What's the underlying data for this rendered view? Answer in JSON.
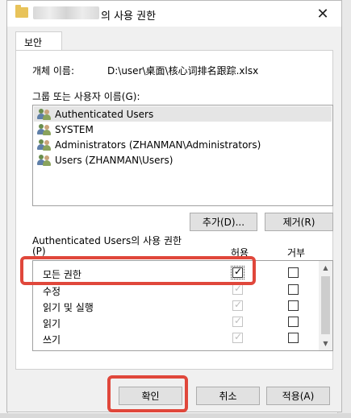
{
  "window": {
    "title": "의 사용 권한",
    "close_glyph": "✕"
  },
  "tab": {
    "label": "보안"
  },
  "object": {
    "label": "개체 이름:",
    "value": "D:\\user\\桌面\\核心词排名跟踪.xlsx"
  },
  "groups": {
    "label": "그룹 또는 사용자 이름(G):",
    "items": [
      {
        "name": "Authenticated Users"
      },
      {
        "name": "SYSTEM"
      },
      {
        "name": "Administrators (ZHANMAN\\Administrators)"
      },
      {
        "name": "Users (ZHANMAN\\Users)"
      }
    ],
    "add_label": "추가(D)...",
    "remove_label": "제거(R)"
  },
  "permissions": {
    "label_line1": "Authenticated Users의 사용 권한",
    "label_line2": "(P)",
    "allow_header": "허용",
    "deny_header": "거부",
    "rows": [
      {
        "name": "모든 권한",
        "allow": true,
        "allow_disabled": false,
        "deny": false
      },
      {
        "name": "수정",
        "allow": true,
        "allow_disabled": true,
        "deny": false
      },
      {
        "name": "읽기 및 실행",
        "allow": true,
        "allow_disabled": true,
        "deny": false
      },
      {
        "name": "읽기",
        "allow": true,
        "allow_disabled": true,
        "deny": false
      },
      {
        "name": "쓰기",
        "allow": true,
        "allow_disabled": true,
        "deny": false
      }
    ]
  },
  "footer": {
    "ok_label": "확인",
    "cancel_label": "취소",
    "apply_label": "적용(A)"
  },
  "colors": {
    "highlight": "#e0473b",
    "selected_row": "#e5e5e5"
  }
}
